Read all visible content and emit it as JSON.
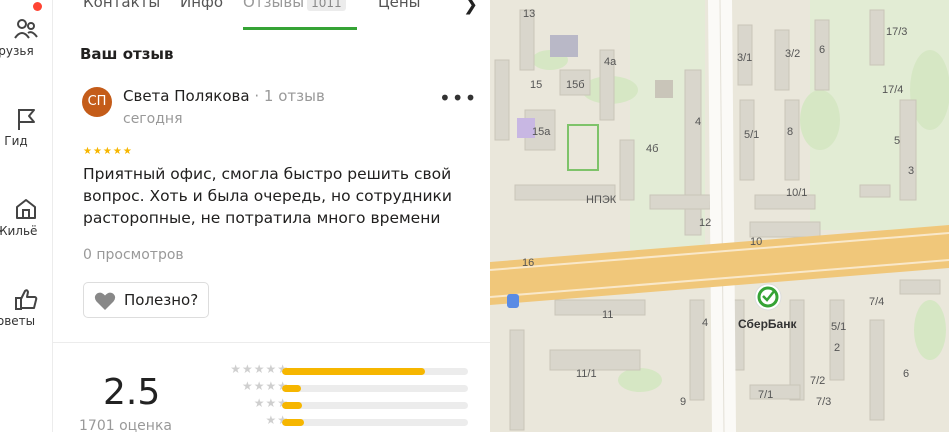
{
  "nav": {
    "items": [
      {
        "label": "рузья",
        "icon": "friends-icon"
      },
      {
        "label": "Гид",
        "icon": "flag-icon"
      },
      {
        "label": "Жильё",
        "icon": "housing-icon"
      },
      {
        "label": "оветы",
        "icon": "thumbs-up-icon"
      }
    ]
  },
  "tabs": [
    {
      "label": "Контакты"
    },
    {
      "label": "Инфо"
    },
    {
      "label": "Отзывы",
      "count": "1011",
      "active": true
    },
    {
      "label": "Цены"
    }
  ],
  "review_section": {
    "title": "Ваш отзыв",
    "author": {
      "initials": "СП",
      "name": "Света Полякова",
      "reviews_count": "1 отзыв",
      "date": "сегодня",
      "avatar_color": "#c45c19"
    },
    "rating": 5,
    "text": "Приятный офис, смогла быстро решить свой вопрос. Хоть и была очередь, но сотрудники расторопные, не потратила много времени",
    "views": "0 просмотров",
    "useful_label": "Полезно?"
  },
  "summary": {
    "score": "2.5",
    "ratings_count": "1701 оценка",
    "distribution": [
      {
        "stars": 5,
        "fraction": 0.77
      },
      {
        "stars": 4,
        "fraction": 0.1
      },
      {
        "stars": 3,
        "fraction": 0.11
      },
      {
        "stars": 2,
        "fraction": 0.12
      }
    ],
    "bar_color": "#f6b600"
  },
  "map": {
    "labels": [
      "13",
      "15",
      "15б",
      "15а",
      "4а",
      "4",
      "4б",
      "НПЭК",
      "12",
      "16",
      "10",
      "11",
      "11/1",
      "10/1",
      "8",
      "5/1",
      "3/1",
      "3/2",
      "6",
      "17/3",
      "17/4",
      "5",
      "3",
      "2",
      "7/1",
      "7/2",
      "7/3",
      "7/4",
      "5/1",
      "4",
      "9",
      "6"
    ],
    "poi_label": "СберБанк",
    "accent_color": "#35a335"
  }
}
